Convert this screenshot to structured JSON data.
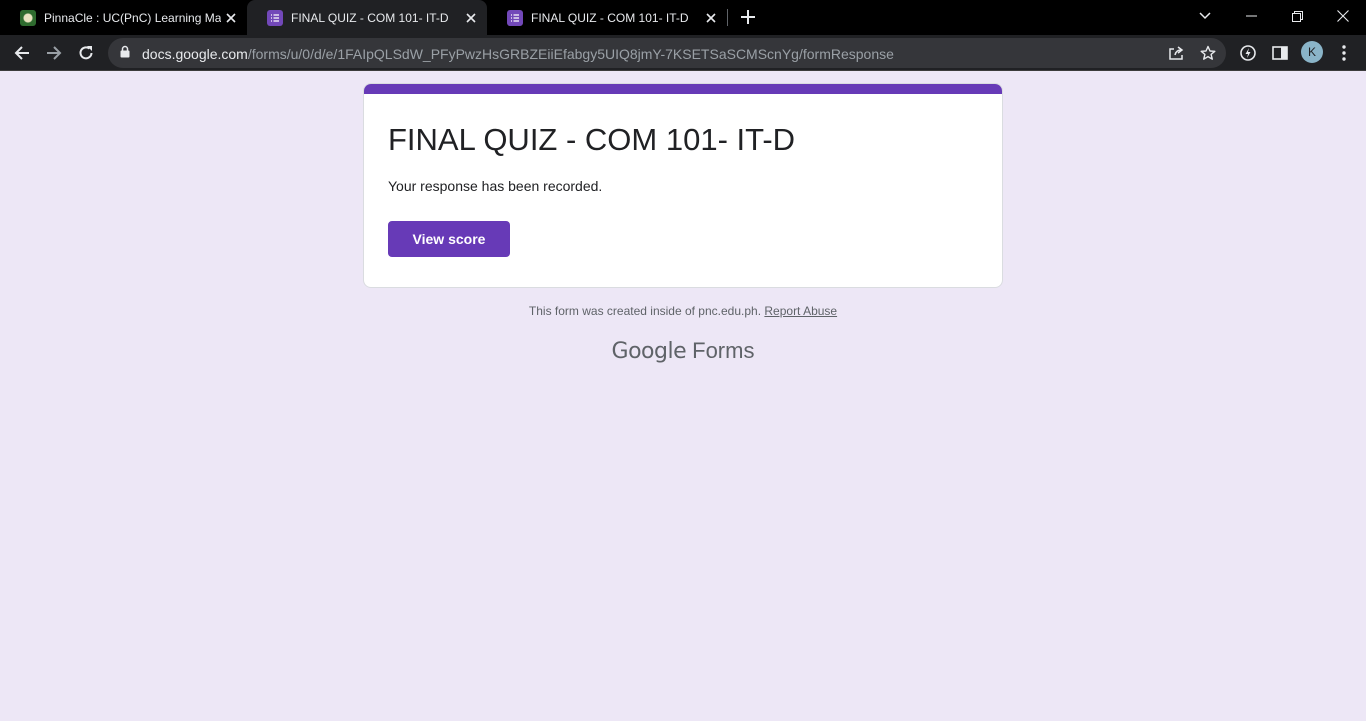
{
  "browser": {
    "tabs": [
      {
        "title": "PinnaCle : UC(PnC) Learning Man",
        "favicon": "pinnacle-logo-icon"
      },
      {
        "title": "FINAL QUIZ - COM 101- IT-D",
        "favicon": "google-forms-icon"
      },
      {
        "title": "FINAL QUIZ - COM 101- IT-D",
        "favicon": "google-forms-icon"
      }
    ],
    "url_host": "docs.google.com",
    "url_path": "/forms/u/0/d/e/1FAIpQLSdW_PFyPwzHsGRBZEiiEfabgy5UIQ8jmY-7KSETSaSCMScnYg/formResponse",
    "profile_initial": "K"
  },
  "form": {
    "title": "FINAL QUIZ - COM 101- IT-D",
    "confirmation": "Your response has been recorded.",
    "view_score_label": "View score",
    "footer_text": "This form was created inside of pnc.edu.ph.",
    "report_abuse": "Report Abuse",
    "brand_google": "Google",
    "brand_forms": "Forms"
  },
  "colors": {
    "accent": "#673ab7",
    "page_bg": "#ede7f6",
    "chrome_bg": "#202124"
  }
}
